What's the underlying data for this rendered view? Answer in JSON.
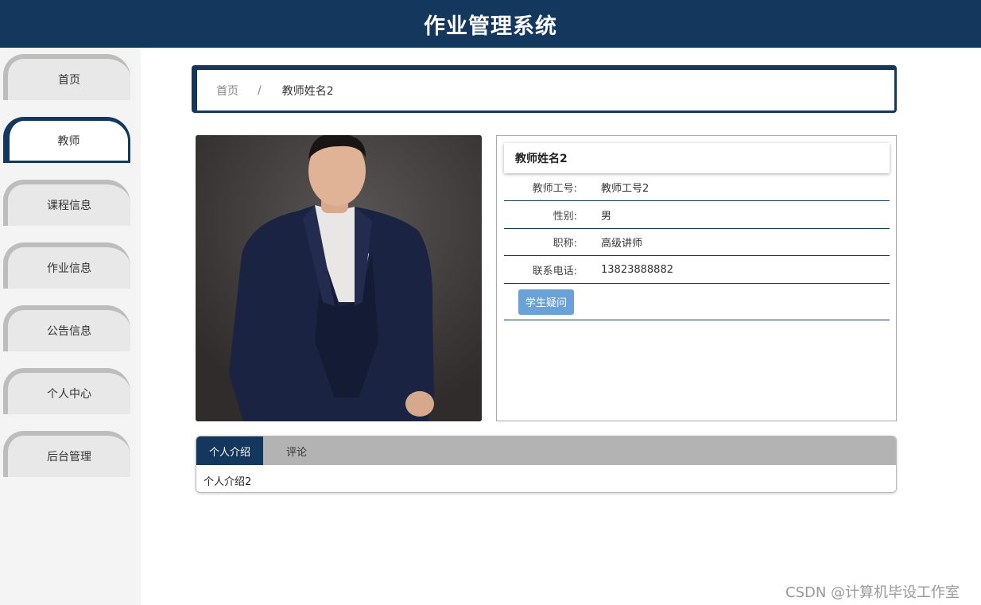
{
  "header": {
    "title": "作业管理系统"
  },
  "sidebar": {
    "items": [
      {
        "label": "首页",
        "active": false
      },
      {
        "label": "教师",
        "active": true
      },
      {
        "label": "课程信息",
        "active": false
      },
      {
        "label": "作业信息",
        "active": false
      },
      {
        "label": "公告信息",
        "active": false
      },
      {
        "label": "个人中心",
        "active": false
      },
      {
        "label": "后台管理",
        "active": false
      }
    ]
  },
  "breadcrumb": {
    "home": "首页",
    "separator": "/",
    "current": "教师姓名2"
  },
  "detail": {
    "name": "教师姓名2",
    "fields": [
      {
        "label": "教师工号:",
        "value": "教师工号2"
      },
      {
        "label": "性别:",
        "value": "男"
      },
      {
        "label": "职称:",
        "value": "高级讲师"
      },
      {
        "label": "联系电话:",
        "value": "13823888882"
      }
    ],
    "question_button": "学生疑问"
  },
  "tabs": {
    "items": [
      {
        "label": "个人介绍",
        "active": true
      },
      {
        "label": "评论",
        "active": false
      }
    ],
    "content": "个人介绍2"
  },
  "watermark": "CSDN @计算机毕设工作室",
  "colors": {
    "primary": "#14375e",
    "button": "#6aa2d8",
    "tab_bar": "#b3b3b3"
  }
}
